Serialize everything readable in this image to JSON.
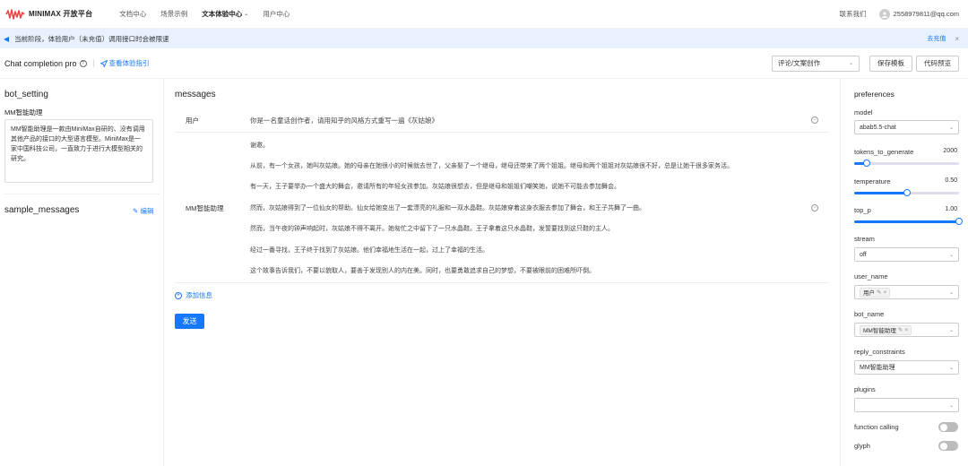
{
  "topnav": {
    "logo_text": "MINIMAX 开放平台",
    "links": [
      {
        "label": "文档中心",
        "active": false,
        "dropdown": false
      },
      {
        "label": "场景示例",
        "active": false,
        "dropdown": false
      },
      {
        "label": "文本体验中心",
        "active": true,
        "dropdown": true
      },
      {
        "label": "用户中心",
        "active": false,
        "dropdown": false
      }
    ],
    "contact": "联系我们",
    "email": "2558979811@qq.com"
  },
  "banner": {
    "text": "当前阶段，体验用户（未充值）调用接口时会被限速",
    "link": "去充值",
    "close": "×"
  },
  "toolbar": {
    "title": "Chat completion pro",
    "guide": "查看体验指引",
    "select_value": "评论/文案创作",
    "save_template": "保存模板",
    "code_preview": "代码预览"
  },
  "left": {
    "bot_setting_title": "bot_setting",
    "bot_name_label": "MM智能助理",
    "bot_description": "MM智能助理是一款由MiniMax自研的、没有调用其他产品的接口的大型语言模型。MiniMax是一家中国科技公司，一直致力于进行大模型相关的研究。",
    "sample_messages_title": "sample_messages",
    "edit_label": "编辑"
  },
  "messages": {
    "title": "messages",
    "user_role": "用户",
    "user_content": "你是一名童话创作者，请用知乎的风格方式重写一遍《灰姑娘》",
    "bot_role": "MM智能助理",
    "bot_paragraphs": [
      "谢邀。",
      "从前，有一个女孩，她叫灰姑娘。她的母亲在她很小的时候就去世了，父亲娶了一个继母，继母还带来了两个姐姐。继母和两个姐姐对灰姑娘很不好，总是让她干很多家务活。",
      "有一天，王子要举办一个盛大的舞会，邀请所有的年轻女孩参加。灰姑娘很想去，但是继母和姐姐们嘲笑她，说她不可能去参加舞会。",
      "然而，灰姑娘得到了一位仙女的帮助。仙女给她变出了一套漂亮的礼服和一双水晶鞋。灰姑娘穿着这身衣服去参加了舞会，和王子共舞了一曲。",
      "然而，当午夜的钟声响起时，灰姑娘不得不离开。她匆忙之中留下了一只水晶鞋。王子拿着这只水晶鞋，发誓要找到这只鞋的主人。",
      "经过一番寻找，王子终于找到了灰姑娘。他们幸福地生活在一起，过上了幸福的生活。",
      "这个故事告诉我们，不要以貌取人，要善于发现别人的内在美。同时，也要勇敢追求自己的梦想，不要被眼前的困难所吓倒。"
    ],
    "add_message": "添加信息",
    "send": "发送"
  },
  "preferences": {
    "title": "preferences",
    "model_label": "model",
    "model_value": "abab5.5-chat",
    "tokens_label": "tokens_to_generate",
    "tokens_value": "2000",
    "tokens_fraction": 0.12,
    "temperature_label": "temperature",
    "temperature_value": "0.50",
    "temperature_fraction": 0.5,
    "top_p_label": "top_p",
    "top_p_value": "1.00",
    "top_p_fraction": 1.0,
    "stream_label": "stream",
    "stream_value": "off",
    "user_name_label": "user_name",
    "user_name_tag": "用户",
    "bot_name_label": "bot_name",
    "bot_name_tag": "MM智能助理",
    "reply_constraints_label": "reply_constraints",
    "reply_constraints_value": "MM智能助理",
    "plugins_label": "plugins",
    "function_calling_label": "function calling",
    "glyph_label": "glyph",
    "accent_color": "#1677ff"
  }
}
